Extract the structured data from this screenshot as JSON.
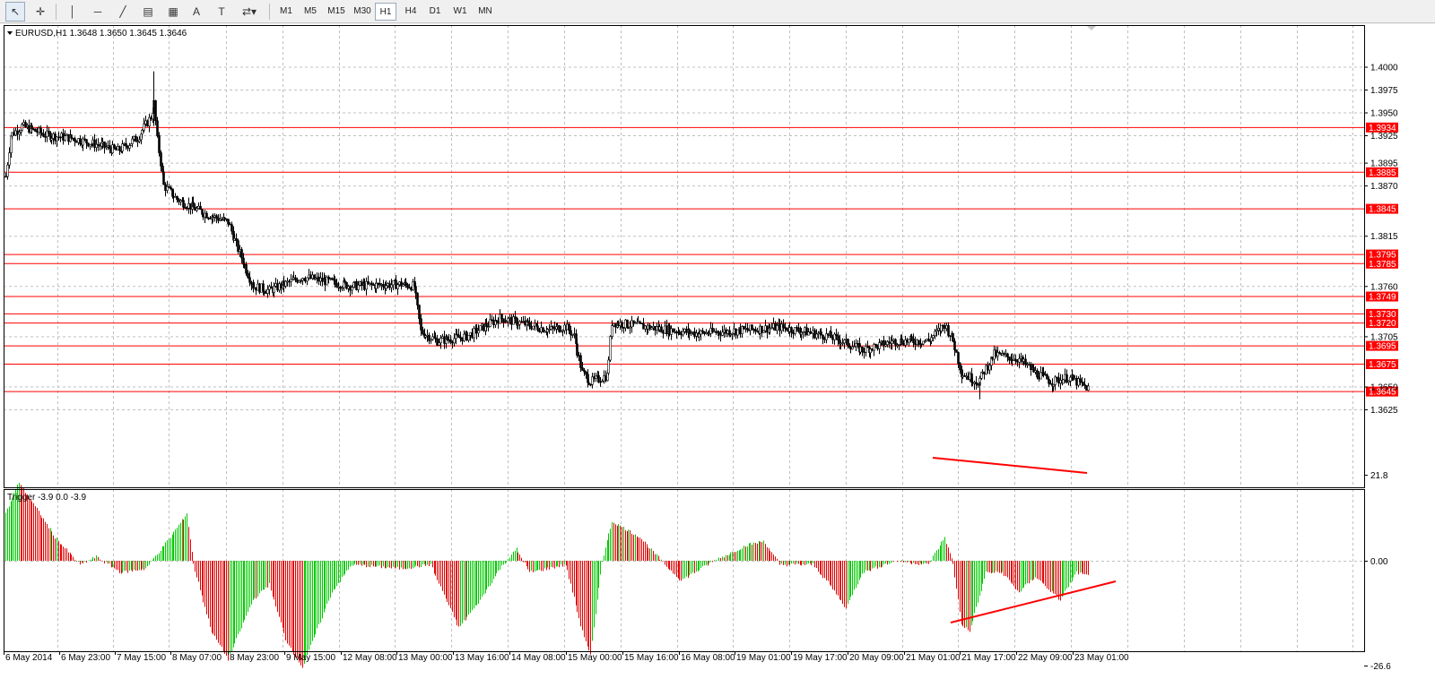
{
  "toolbar": {
    "tools": [
      {
        "name": "cursor-arrow-icon",
        "glyph": "↖",
        "active": true
      },
      {
        "name": "crosshair-icon",
        "glyph": "✛",
        "active": false
      },
      {
        "name": "vertical-line-icon",
        "glyph": "│",
        "active": false
      },
      {
        "name": "horizontal-line-icon",
        "glyph": "─",
        "active": false
      },
      {
        "name": "trend-line-icon",
        "glyph": "╱",
        "active": false
      },
      {
        "name": "equidistant-channel-icon",
        "glyph": "▤",
        "active": false
      },
      {
        "name": "fibonacci-icon",
        "glyph": "▦",
        "active": false
      },
      {
        "name": "text-icon",
        "glyph": "A",
        "active": false
      },
      {
        "name": "text-label-icon",
        "glyph": "T",
        "active": false
      },
      {
        "name": "arrows-icon",
        "glyph": "⇄▾",
        "active": false
      }
    ],
    "timeframes": [
      "M1",
      "M5",
      "M15",
      "M30",
      "H1",
      "H4",
      "D1",
      "W1",
      "MN"
    ],
    "active_timeframe": "H1"
  },
  "chart": {
    "header": "EURUSD,H1  1.3648 1.3650 1.3645 1.3646",
    "price_ticks": [
      "1.4000",
      "1.3975",
      "1.3950",
      "1.3925",
      "1.3895",
      "1.3870",
      "1.3815",
      "1.3760",
      "1.3705",
      "1.3650",
      "1.3625"
    ],
    "level_lines": [
      "1.3934",
      "1.3885",
      "1.3845",
      "1.3795",
      "1.3785",
      "1.3749",
      "1.3730",
      "1.3720",
      "1.3695",
      "1.3675",
      "1.3645"
    ],
    "time_labels": [
      "6 May 2014",
      "6 May 23:00",
      "7 May 15:00",
      "8 May 07:00",
      "8 May 23:00",
      "9 May 15:00",
      "12 May 08:00",
      "13 May 00:00",
      "13 May 16:00",
      "14 May 08:00",
      "15 May 00:00",
      "15 May 16:00",
      "16 May 08:00",
      "19 May 01:00",
      "19 May 17:00",
      "20 May 09:00",
      "21 May 01:00",
      "21 May 17:00",
      "22 May 09:00",
      "23 May 01:00"
    ],
    "colors": {
      "up": "#000000",
      "down": "#000000",
      "level": "#ff0000",
      "level_label_bg": "#ff0000",
      "grid": "#c0c0c0"
    }
  },
  "indicator": {
    "header": "Trigger -3.9 0.0 -3.9",
    "ticks": [
      "21.8",
      "0.00",
      "-26.6"
    ],
    "colors": {
      "positive": "#00c800",
      "negative": "#e00000"
    }
  },
  "chart_data": {
    "type": "candlestick",
    "symbol": "EURUSD",
    "timeframe": "H1",
    "ylim": [
      1.3615,
      1.4015
    ],
    "price_keypoints": [
      [
        0,
        1.388
      ],
      [
        3,
        1.3925
      ],
      [
        10,
        1.3935
      ],
      [
        25,
        1.3925
      ],
      [
        40,
        1.3922
      ],
      [
        55,
        1.3915
      ],
      [
        68,
        1.3908
      ],
      [
        80,
        1.3922
      ],
      [
        88,
        1.3945
      ],
      [
        90,
        1.396
      ],
      [
        92,
        1.392
      ],
      [
        96,
        1.387
      ],
      [
        104,
        1.3855
      ],
      [
        120,
        1.384
      ],
      [
        135,
        1.383
      ],
      [
        140,
        1.3805
      ],
      [
        150,
        1.376
      ],
      [
        160,
        1.3755
      ],
      [
        180,
        1.377
      ],
      [
        210,
        1.376
      ],
      [
        240,
        1.3762
      ],
      [
        248,
        1.376
      ],
      [
        252,
        1.371
      ],
      [
        262,
        1.37
      ],
      [
        280,
        1.3705
      ],
      [
        300,
        1.3725
      ],
      [
        330,
        1.3712
      ],
      [
        340,
        1.3716
      ],
      [
        345,
        1.3705
      ],
      [
        350,
        1.3665
      ],
      [
        355,
        1.3655
      ],
      [
        365,
        1.3662
      ],
      [
        368,
        1.372
      ],
      [
        390,
        1.3715
      ],
      [
        420,
        1.3708
      ],
      [
        450,
        1.3712
      ],
      [
        470,
        1.3715
      ],
      [
        500,
        1.3705
      ],
      [
        520,
        1.369
      ],
      [
        540,
        1.37
      ],
      [
        560,
        1.37
      ],
      [
        570,
        1.3718
      ],
      [
        575,
        1.37
      ],
      [
        580,
        1.3665
      ],
      [
        590,
        1.3655
      ],
      [
        600,
        1.3685
      ],
      [
        615,
        1.368
      ],
      [
        625,
        1.3665
      ],
      [
        635,
        1.3655
      ],
      [
        645,
        1.366
      ],
      [
        657,
        1.3648
      ]
    ],
    "indicator": {
      "name": "Trigger",
      "ylim": [
        -26.6,
        21.8
      ],
      "keypoints": [
        [
          0,
          12
        ],
        [
          8,
          20
        ],
        [
          16,
          15
        ],
        [
          30,
          6
        ],
        [
          45,
          -1
        ],
        [
          55,
          1
        ],
        [
          70,
          -3
        ],
        [
          85,
          -2
        ],
        [
          100,
          6
        ],
        [
          110,
          12
        ],
        [
          114,
          -1
        ],
        [
          125,
          -18
        ],
        [
          135,
          -25
        ],
        [
          150,
          -10
        ],
        [
          160,
          -6
        ],
        [
          170,
          -20
        ],
        [
          180,
          -27
        ],
        [
          198,
          -8
        ],
        [
          210,
          -1
        ],
        [
          240,
          -2
        ],
        [
          258,
          -1
        ],
        [
          260,
          -3
        ],
        [
          275,
          -17
        ],
        [
          288,
          -10
        ],
        [
          300,
          -2
        ],
        [
          310,
          3
        ],
        [
          318,
          -3
        ],
        [
          340,
          -1
        ],
        [
          350,
          -18
        ],
        [
          355,
          -24
        ],
        [
          362,
          0
        ],
        [
          368,
          10
        ],
        [
          385,
          6
        ],
        [
          400,
          -1
        ],
        [
          410,
          -5
        ],
        [
          430,
          0
        ],
        [
          450,
          4
        ],
        [
          460,
          5
        ],
        [
          470,
          -1
        ],
        [
          490,
          -1
        ],
        [
          500,
          -6
        ],
        [
          510,
          -12
        ],
        [
          520,
          -3
        ],
        [
          540,
          0
        ],
        [
          560,
          -1
        ],
        [
          570,
          6
        ],
        [
          575,
          -1
        ],
        [
          580,
          -16
        ],
        [
          585,
          -18
        ],
        [
          595,
          -3
        ],
        [
          605,
          -3
        ],
        [
          615,
          -8
        ],
        [
          625,
          -4
        ],
        [
          640,
          -10
        ],
        [
          650,
          -3
        ],
        [
          657,
          -3.9
        ]
      ]
    }
  }
}
